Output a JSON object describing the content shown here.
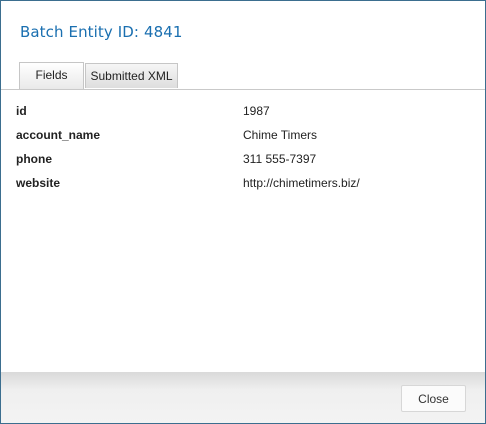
{
  "dialog": {
    "title": "Batch Entity ID: 4841"
  },
  "tabs": [
    {
      "label": "Fields",
      "active": true
    },
    {
      "label": "Submitted XML",
      "active": false
    }
  ],
  "fields": [
    {
      "label": "id",
      "value": "1987"
    },
    {
      "label": "account_name",
      "value": "Chime Timers"
    },
    {
      "label": "phone",
      "value": "311 555-7397"
    },
    {
      "label": "website",
      "value": "http://chimetimers.biz/"
    }
  ],
  "footer": {
    "close_label": "Close"
  },
  "colors": {
    "title": "#1a6fb0",
    "border": "#3b6e8f"
  }
}
